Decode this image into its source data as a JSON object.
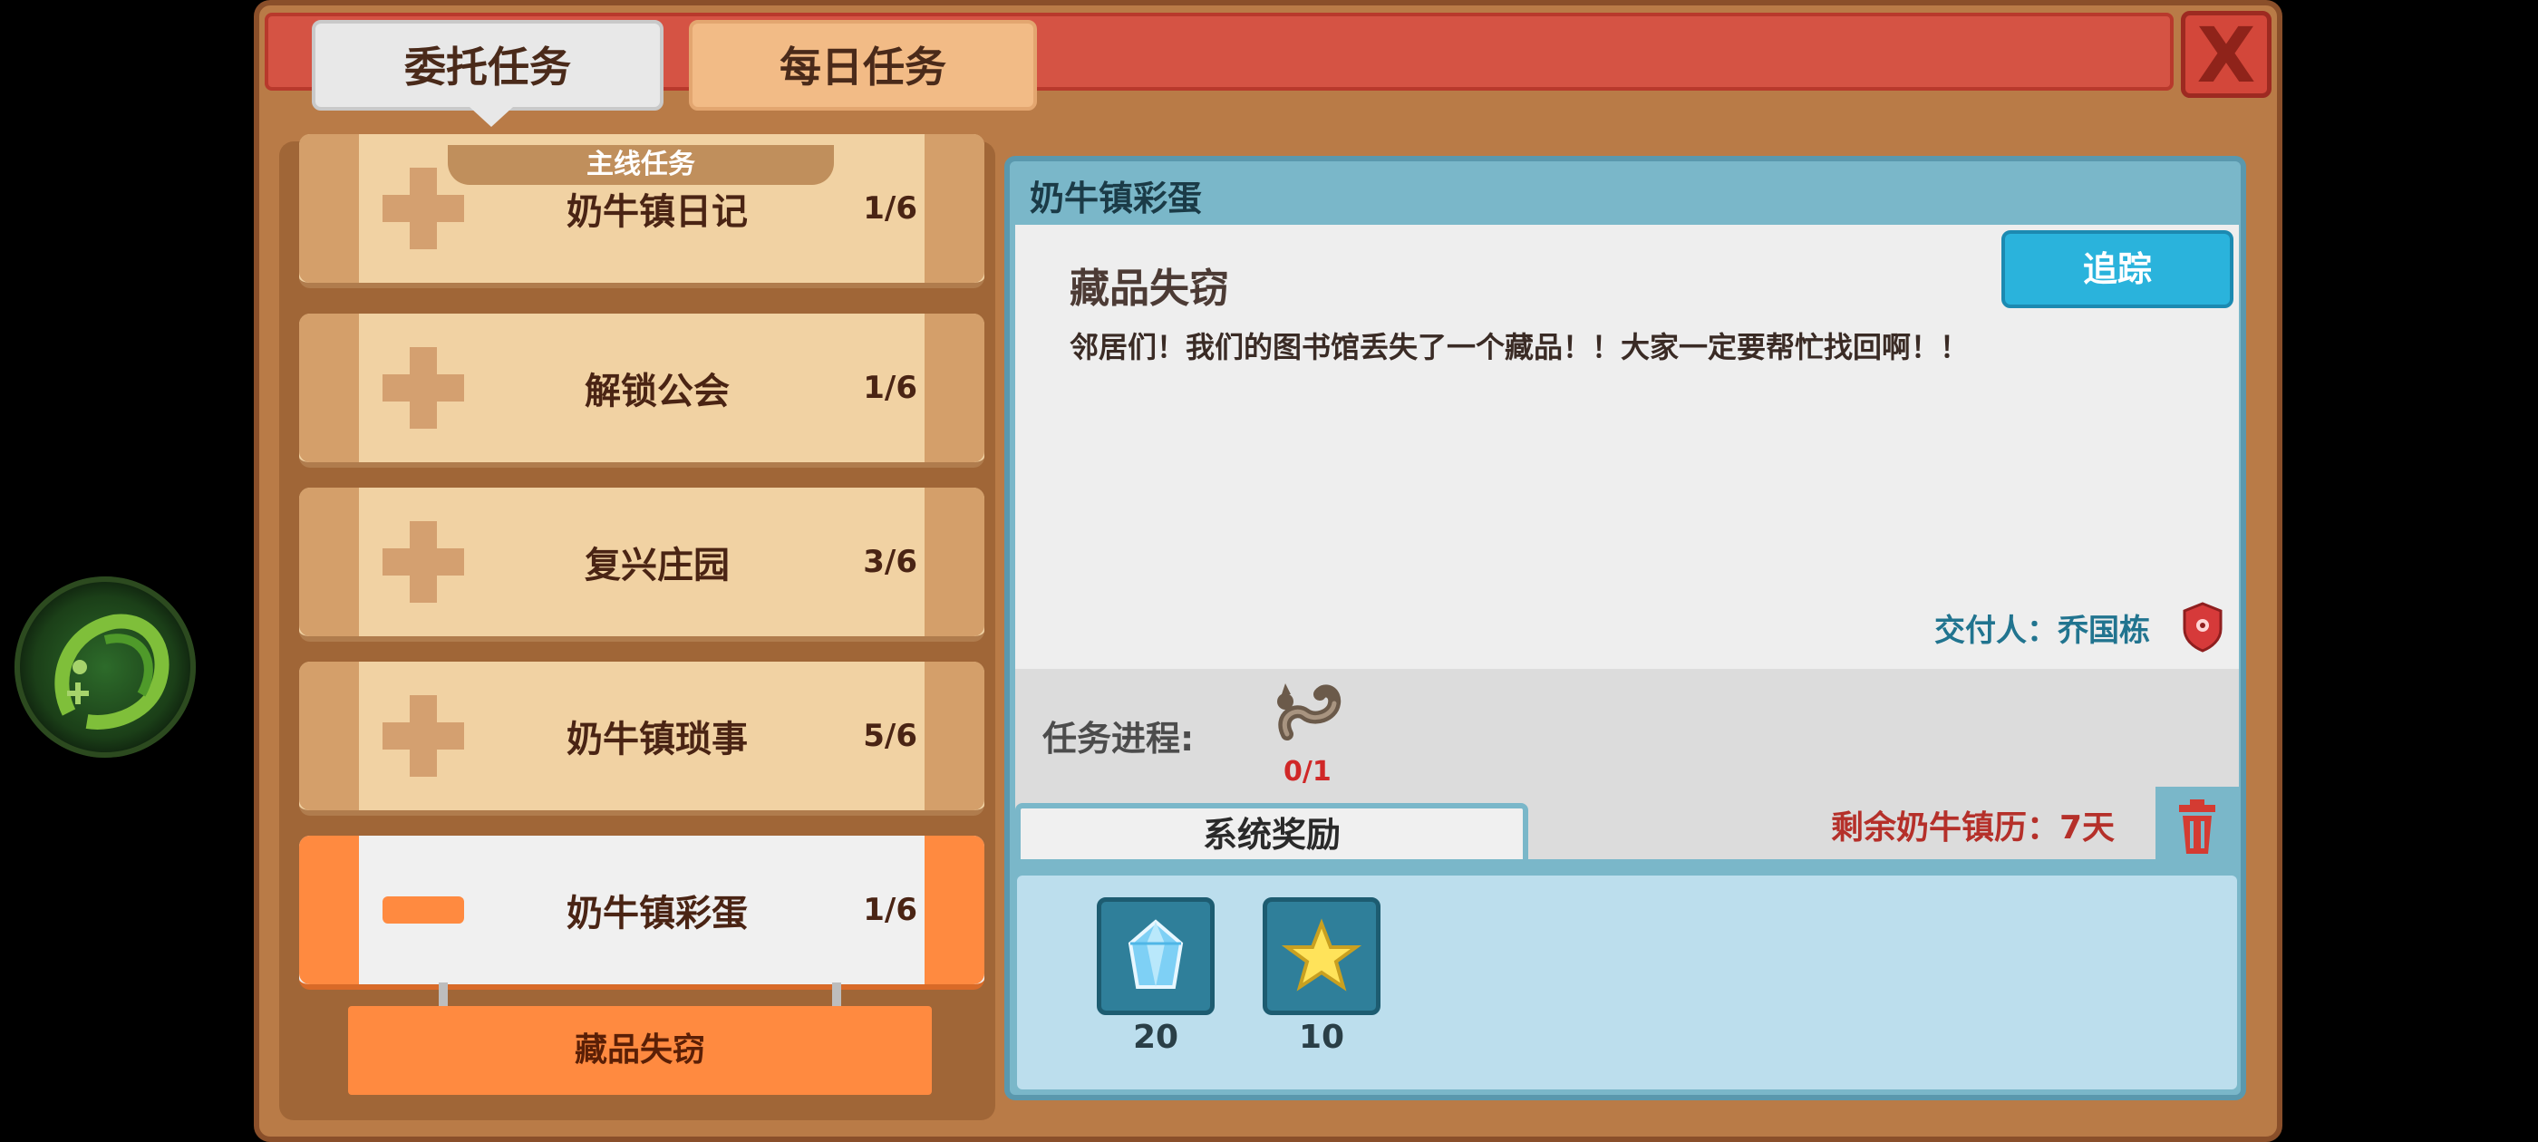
{
  "tabs": [
    {
      "label": "委托任务"
    },
    {
      "label": "每日任务"
    }
  ],
  "close_label": "X",
  "section_label": "主线任务",
  "quest_groups": [
    {
      "name": "奶牛镇日记",
      "count": "1/6"
    },
    {
      "name": "解锁公会",
      "count": "1/6"
    },
    {
      "name": "复兴庄园",
      "count": "3/6"
    },
    {
      "name": "奶牛镇琐事",
      "count": "5/6"
    },
    {
      "name": "奶牛镇彩蛋",
      "count": "1/6"
    }
  ],
  "selected_sub_quest": "藏品失窃",
  "detail": {
    "header": "奶牛镇彩蛋",
    "title": "藏品失窃",
    "description": "邻居们！我们的图书馆丢失了一个藏品！！大家一定要帮忙找回啊！！",
    "track_label": "追踪",
    "giver": "交付人：乔国栋",
    "progress_label": "任务进程:",
    "progress_count": "0/1",
    "reward_tab_label": "系统奖励",
    "remaining": "剩余奶牛镇历：7天",
    "rewards": [
      {
        "icon": "crystal-icon",
        "amount": "20"
      },
      {
        "icon": "star-icon",
        "amount": "10"
      }
    ]
  },
  "colors": {
    "accent_orange": "#ff8a40",
    "header_red": "#d55344",
    "panel_blue": "#7ab7c9",
    "track_blue": "#2ab3dc"
  }
}
